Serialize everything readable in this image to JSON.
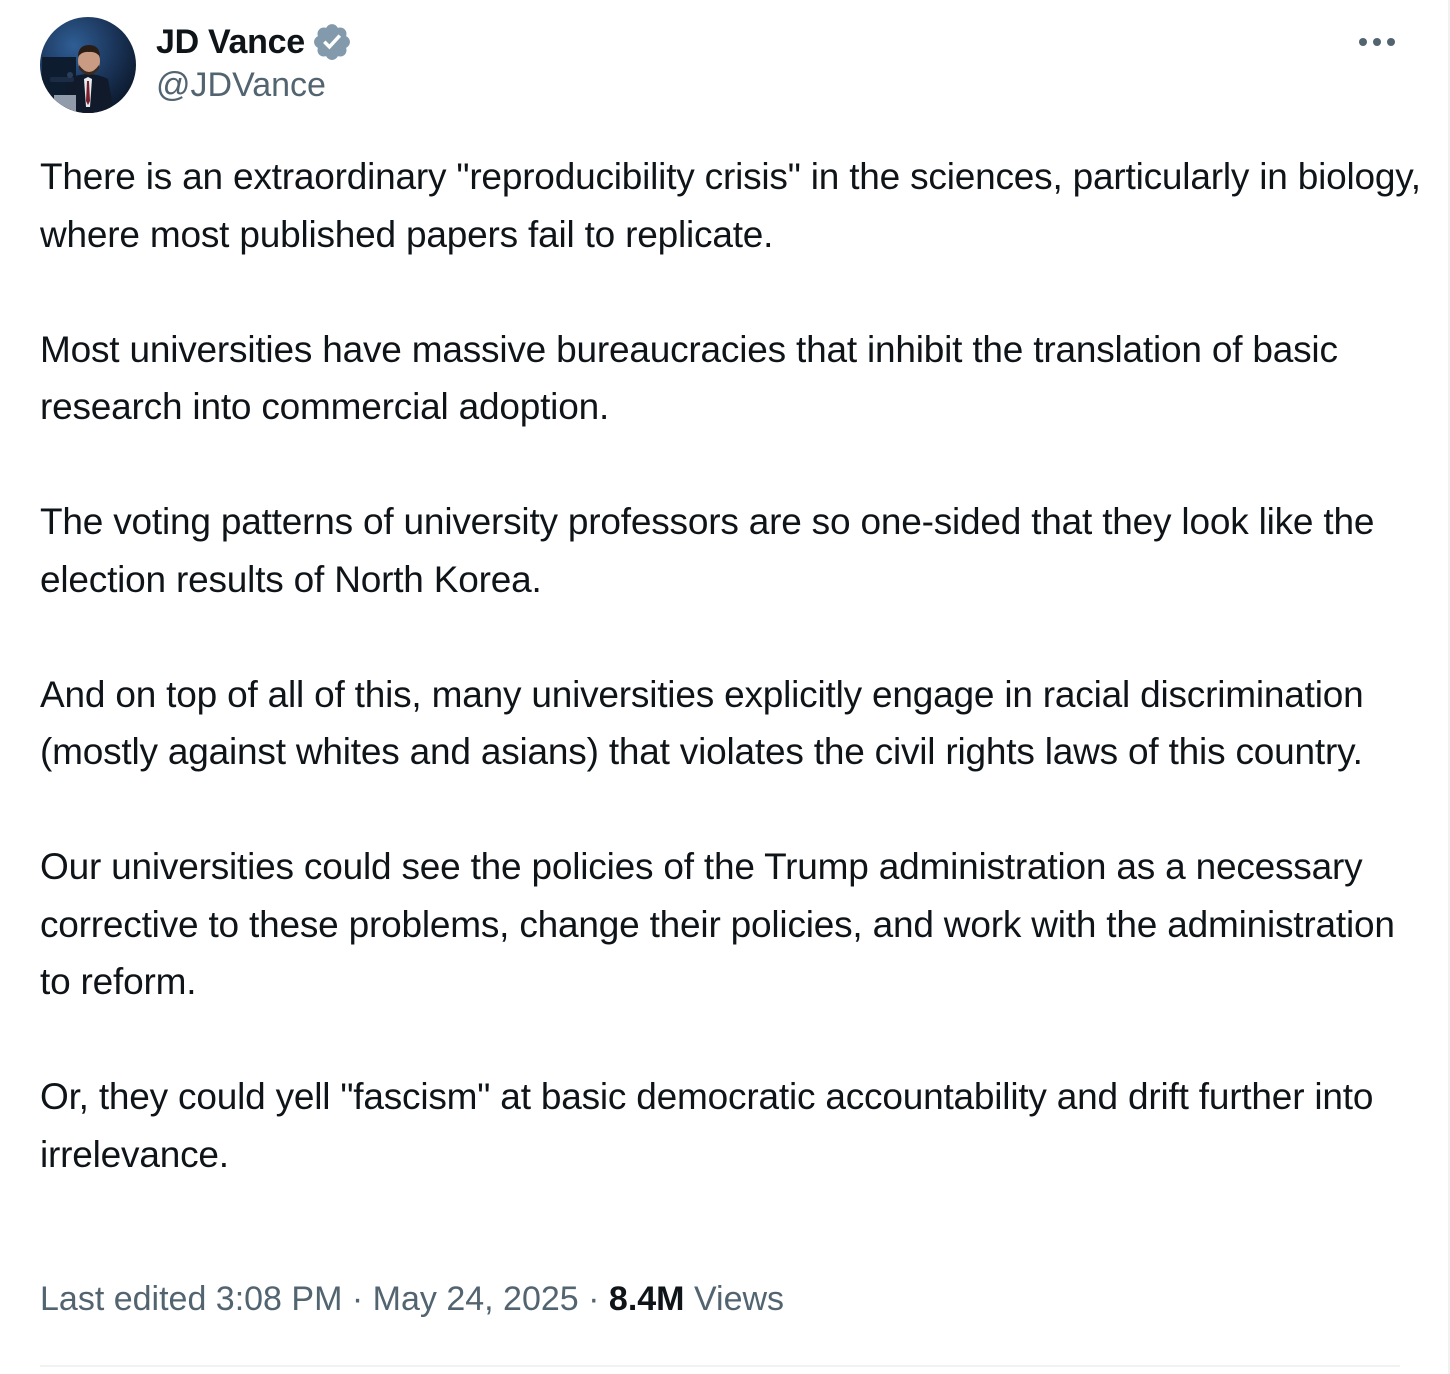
{
  "author": {
    "display_name": "JD Vance",
    "handle": "@JDVance",
    "verified": true,
    "avatar_icon": "avatar-photo"
  },
  "more_icon": "more-horizontal-icon",
  "tweet": {
    "paragraphs": [
      "There is an extraordinary \"reproducibility crisis\" in the sciences, particularly in biology, where most published papers fail to replicate.",
      "Most universities have massive bureaucracies that inhibit the translation of basic research into commercial adoption.",
      "The voting patterns of university professors are so one-sided that they look like the election results of North Korea.",
      "And on top of all of this, many universities explicitly engage in racial discrimination (mostly against whites and asians) that violates the civil rights laws of this country.",
      "Our universities could see the policies of the Trump administration as a necessary corrective to these problems, change their policies, and work with the administration to reform.",
      "Or, they could yell \"fascism\" at basic democratic accountability and drift further into irrelevance."
    ]
  },
  "meta": {
    "edited_label": "Last edited 3:08 PM",
    "separator": "·",
    "date": "May 24, 2025",
    "views_count": "8.4M",
    "views_label": "Views"
  },
  "colors": {
    "text_primary": "#0f1419",
    "text_secondary": "#536471",
    "verified_badge": "#829aab",
    "divider": "#eff3f4"
  }
}
